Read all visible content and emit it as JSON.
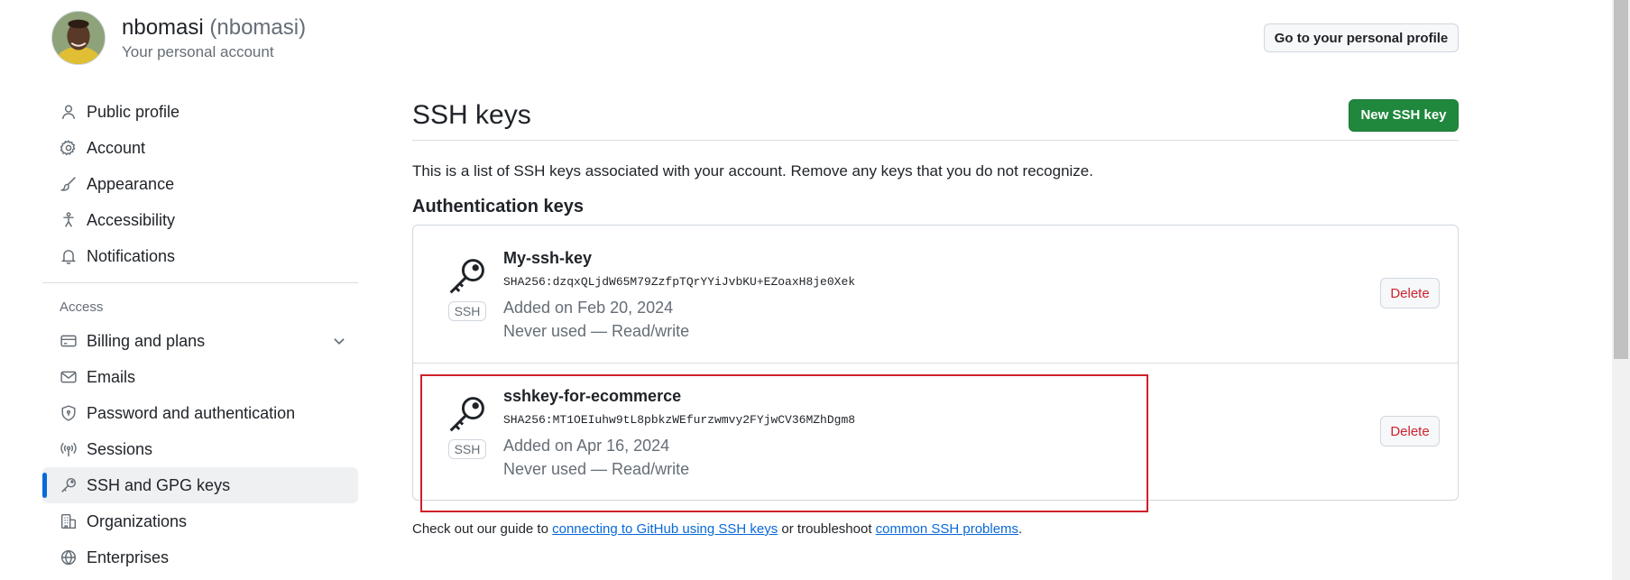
{
  "account": {
    "name": "nbomasi",
    "login": "(nbomasi)",
    "subtitle": "Your personal account",
    "profile_button": "Go to your personal profile"
  },
  "sidebar": {
    "items": [
      {
        "label": "Public profile",
        "icon": "person-icon"
      },
      {
        "label": "Account",
        "icon": "gear-icon"
      },
      {
        "label": "Appearance",
        "icon": "paintbrush-icon"
      },
      {
        "label": "Accessibility",
        "icon": "accessibility-icon"
      },
      {
        "label": "Notifications",
        "icon": "bell-icon"
      }
    ],
    "access_heading": "Access",
    "access_items": [
      {
        "label": "Billing and plans",
        "icon": "credit-card-icon",
        "expandable": true
      },
      {
        "label": "Emails",
        "icon": "mail-icon"
      },
      {
        "label": "Password and authentication",
        "icon": "shield-icon"
      },
      {
        "label": "Sessions",
        "icon": "broadcast-icon"
      },
      {
        "label": "SSH and GPG keys",
        "icon": "key-icon",
        "selected": true
      },
      {
        "label": "Organizations",
        "icon": "organization-icon"
      },
      {
        "label": "Enterprises",
        "icon": "globe-icon"
      }
    ]
  },
  "main": {
    "title": "SSH keys",
    "new_button": "New SSH key",
    "intro": "This is a list of SSH keys associated with your account. Remove any keys that you do not recognize.",
    "section_title": "Authentication keys",
    "keys": [
      {
        "title": "My-ssh-key",
        "fingerprint": "SHA256:dzqxQLjdW65M79ZzfpTQrYYiJvbKU+EZoaxH8je0Xek",
        "added": "Added on Feb 20, 2024",
        "usage": "Never used — Read/write",
        "badge": "SSH",
        "delete_label": "Delete"
      },
      {
        "title": "sshkey-for-ecommerce",
        "fingerprint": "SHA256:MT1OEIuhw9tL8pbkzWEfurzwmvy2FYjwCV36MZhDgm8",
        "added": "Added on Apr 16, 2024",
        "usage": "Never used — Read/write",
        "badge": "SSH",
        "delete_label": "Delete"
      }
    ],
    "footer": {
      "prefix": "Check out our guide to ",
      "link1": "connecting to GitHub using SSH keys",
      "middle": " or troubleshoot ",
      "link2": "common SSH problems",
      "suffix": "."
    }
  },
  "colors": {
    "primary_green": "#1f883d",
    "danger_red": "#cf222e",
    "link_blue": "#0969da",
    "highlight_red": "#d0202b"
  }
}
